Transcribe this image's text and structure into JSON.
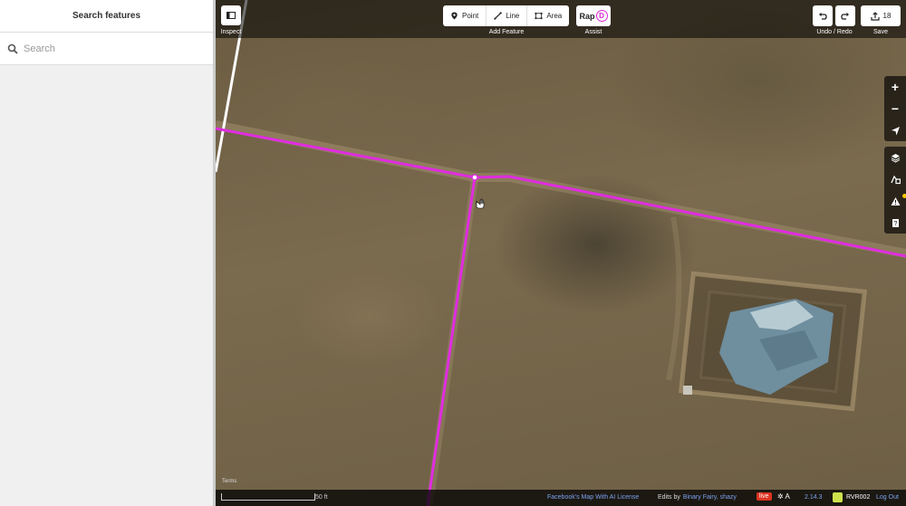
{
  "sidebar": {
    "title": "Search features",
    "search_placeholder": "Search"
  },
  "toolbar": {
    "inspect_label": "Inspect",
    "add_feature_label": "Add Feature",
    "point_label": "Point",
    "line_label": "Line",
    "area_label": "Area",
    "assist_label": "Assist",
    "rapid_text": "Rap",
    "rapid_d": "D",
    "undo_redo_label": "Undo / Redo",
    "save_label": "Save",
    "save_count": "18"
  },
  "map_controls": {
    "zoom_in": "+",
    "zoom_out": "−"
  },
  "footer": {
    "scale_label": "50 ft",
    "license_link": "Facebook's Map With AI License",
    "edits_by_prefix": "Edits by",
    "edits_by_users": "Binary Fairy, shazy",
    "live_badge": "live",
    "version": "2.14.3",
    "user_name": "RVR002",
    "logout": "Log Out",
    "terms": "Terms"
  },
  "colors": {
    "way_color": "#e02ce0",
    "rapid_accent": "#da26d3",
    "live_badge": "#dd3322",
    "issues_dot": "#f5c800",
    "link": "#7aa2f0"
  }
}
